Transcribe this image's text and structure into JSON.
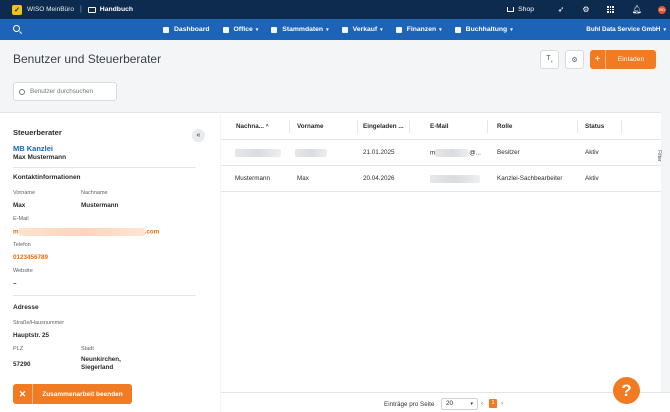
{
  "topbar": {
    "app_name": "WISO MeinBüro",
    "separator": "|",
    "handbook": "Handbuch",
    "shop": "Shop",
    "avatar_initials": "BD"
  },
  "navbar": {
    "items": [
      {
        "label": "Dashboard",
        "chevron": ""
      },
      {
        "label": "Office",
        "chevron": "▾"
      },
      {
        "label": "Stammdaten",
        "chevron": "▾"
      },
      {
        "label": "Verkauf",
        "chevron": "▾"
      },
      {
        "label": "Finanzen",
        "chevron": "▾"
      },
      {
        "label": "Buchhaltung",
        "chevron": "▾"
      }
    ],
    "company": "Buhl Data Service GmbH",
    "company_chevron": "▾"
  },
  "page": {
    "title": "Benutzer und Steuerberater",
    "invite_label": "Einladen",
    "search_placeholder": "Benutzer durchsuchen"
  },
  "left_panel": {
    "title": "Steuerberater",
    "collapse_symbol": "«",
    "kanzlei": "MB Kanzlei",
    "contact_name": "Max Mustermann",
    "contact_info_title": "Kontaktinformationen",
    "first_name_label": "Vorname",
    "first_name": "Max",
    "last_name_label": "Nachname",
    "last_name": "Mustermann",
    "email_label": "E-Mail",
    "email_prefix": "m",
    "email_suffix": ".com",
    "phone_label": "Telefon",
    "phone": "0123456789",
    "website_label": "Website",
    "website": "–",
    "address_title": "Adresse",
    "street_label": "Straße/Hausnummer",
    "street": "Hauptstr. 25",
    "zip_label": "PLZ",
    "zip": "57290",
    "city_label": "Stadt",
    "city": "Neunkirchen, Siegerland",
    "end_button": "Zusammenarbeit beenden"
  },
  "table": {
    "columns": [
      "Nachna...",
      "Vorname",
      "Eingeladen ...",
      "E-Mail",
      "Rolle",
      "Status"
    ],
    "sort_indicator": "^",
    "rows": [
      {
        "nachname": "",
        "vorname": "",
        "eingeladen": "21.01.2025",
        "email_prefix": "m",
        "email_suffix": "@...",
        "rolle": "Besitzer",
        "status": "Aktiv"
      },
      {
        "nachname": "Mustermann",
        "vorname": "Max",
        "eingeladen": "20.04.2026",
        "email_prefix": "",
        "email_suffix": "",
        "rolle": "Kanzlei-Sachbearbeiter",
        "status": "Aktiv"
      }
    ],
    "filter_tab": "Filter"
  },
  "pager": {
    "entries_label": "Einträge pro Seite",
    "page_size": "20",
    "current_page": "1"
  },
  "help_symbol": "?"
}
